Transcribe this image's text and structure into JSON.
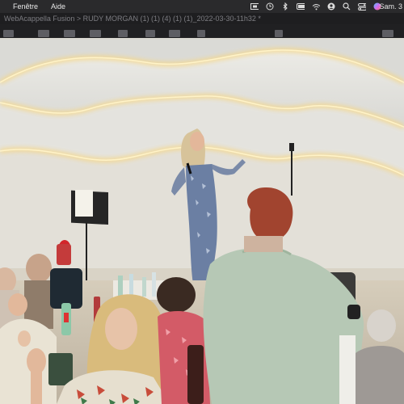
{
  "menubar": {
    "items": [
      "Fenêtre",
      "Aide"
    ],
    "clock": "Sam. 3",
    "status_icons": [
      "screen-record-icon",
      "history-icon",
      "bluetooth-icon",
      "battery-icon",
      "wifi-icon",
      "user-icon",
      "search-icon",
      "control-center-icon",
      "siri-icon"
    ]
  },
  "titlebar": {
    "text": "WebAcappella Fusion > RUDY MORGAN (1) (1) (4) (1) (1)_2022-03-30-11h32 *"
  },
  "colors": {
    "menubar_bg": "#2a2a2c",
    "titlebar_text": "#7d7d82",
    "stage_light": "#f4d27a"
  },
  "video": {
    "scene": "live-performance-frame"
  }
}
